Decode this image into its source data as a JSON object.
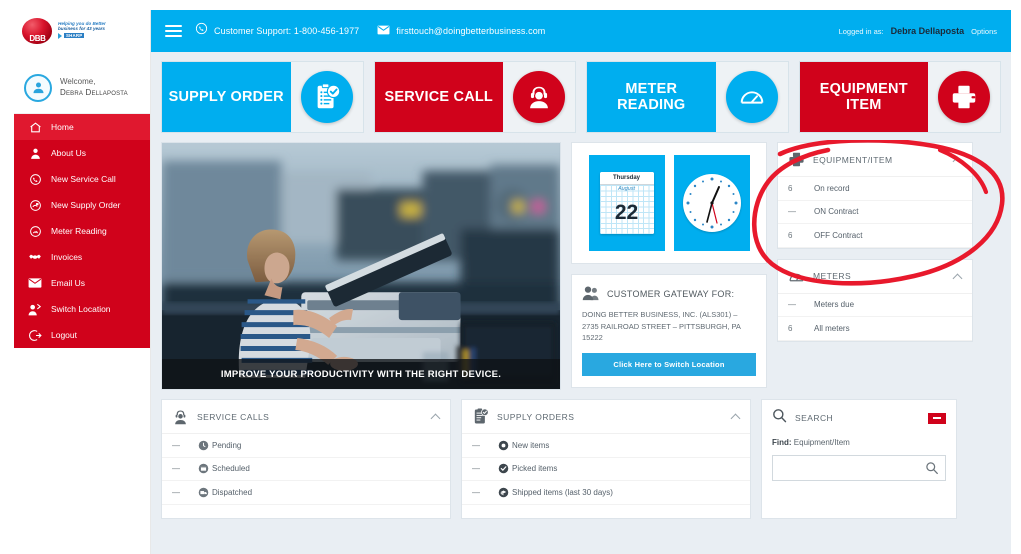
{
  "brand": {
    "mark_text": "DBB",
    "tagline_line1": "Helping you do Better",
    "tagline_line2": "business for 43 years",
    "tagline_sub": "SHARP"
  },
  "welcome": {
    "greeting": "Welcome,",
    "user_name": "Debra Dellaposta",
    "avatar_icon": "user-avatar-icon"
  },
  "sidebar": {
    "items": [
      {
        "label": "Home",
        "icon": "home-icon",
        "active": true
      },
      {
        "label": "About Us",
        "icon": "person-icon",
        "active": false
      },
      {
        "label": "New Service Call",
        "icon": "phone-icon",
        "active": false
      },
      {
        "label": "New Supply Order",
        "icon": "box-hand-icon",
        "active": false
      },
      {
        "label": "Meter Reading",
        "icon": "gauge-icon",
        "active": false
      },
      {
        "label": "Invoices",
        "icon": "handshake-icon",
        "active": false
      },
      {
        "label": "Email Us",
        "icon": "envelope-icon",
        "active": false
      },
      {
        "label": "Switch Location",
        "icon": "switch-user-icon",
        "active": false
      },
      {
        "label": "Logout",
        "icon": "logout-icon",
        "active": false
      }
    ]
  },
  "topbar": {
    "menu_icon": "hamburger-icon",
    "phone_icon": "phone-icon",
    "support_text": "Customer Support: 1-800-456-1977",
    "mail_icon": "envelope-icon",
    "email_text": "firsttouch@doingbetterbusiness.com",
    "logged_in_label": "Logged in as:",
    "user_name": "Debra Dellaposta",
    "options_label": "Options"
  },
  "tiles": [
    {
      "label": "SUPPLY ORDER",
      "color": "#00aeef",
      "style": "blue",
      "icon": "clipboard-check-icon"
    },
    {
      "label": "SERVICE CALL",
      "color": "#d0021b",
      "style": "red",
      "icon": "headset-agent-icon"
    },
    {
      "label": "METER READING",
      "color": "#00aeef",
      "style": "blue",
      "icon": "gauge-icon"
    },
    {
      "label": "EQUIPMENT ITEM",
      "color": "#d0021b",
      "style": "red",
      "icon": "printer-icon"
    }
  ],
  "hero": {
    "caption": "IMPROVE YOUR PRODUCTIVITY WITH THE RIGHT DEVICE.",
    "image_alt": "woman using office copier"
  },
  "datetime": {
    "weekday": "Thursday",
    "month": "August",
    "day": "22",
    "calendar_icon": "calendar-icon",
    "clock_icon": "analog-clock-icon"
  },
  "gateway": {
    "icon": "customers-icon",
    "title": "CUSTOMER GATEWAY FOR:",
    "address": "DOING BETTER BUSINESS, INC. (ALS301) – 2735 RAILROAD STREET – PITTSBURGH, PA 15222",
    "button_label": "Click Here to Switch Location"
  },
  "equipment_panel": {
    "icon": "printer-icon",
    "title": "EQUIPMENT/ITEM",
    "collapse_icon": "chevron-up-icon",
    "rows": [
      {
        "value": "6",
        "label": "On record"
      },
      {
        "value": "—",
        "label": "ON Contract"
      },
      {
        "value": "6",
        "label": "OFF Contract"
      }
    ]
  },
  "meters_panel": {
    "icon": "gauge-icon",
    "title": "METERS",
    "collapse_icon": "chevron-up-icon",
    "rows": [
      {
        "value": "—",
        "label": "Meters due"
      },
      {
        "value": "6",
        "label": "All meters"
      }
    ]
  },
  "service_calls_panel": {
    "icon": "headset-agent-icon",
    "title": "SERVICE CALLS",
    "collapse_icon": "chevron-up-icon",
    "rows": [
      {
        "value": "—",
        "label": "Pending",
        "dot": "clock-dot-icon"
      },
      {
        "value": "—",
        "label": "Scheduled",
        "dot": "calendar-dot-icon"
      },
      {
        "value": "—",
        "label": "Dispatched",
        "dot": "truck-dot-icon"
      }
    ]
  },
  "supply_orders_panel": {
    "icon": "clipboard-check-icon",
    "title": "SUPPLY ORDERS",
    "collapse_icon": "chevron-up-icon",
    "rows": [
      {
        "value": "—",
        "label": "New items",
        "dot": "gear-dot-icon"
      },
      {
        "value": "—",
        "label": "Picked items",
        "dot": "check-dot-icon"
      },
      {
        "value": "—",
        "label": "Shipped items (last 30 days)",
        "dot": "box-dot-icon"
      }
    ]
  },
  "search_panel": {
    "icon": "search-icon",
    "title": "SEARCH",
    "badge_icon": "minimize-badge-icon",
    "find_label": "Find:",
    "find_value": "Equipment/Item",
    "input_value": "",
    "input_placeholder": "",
    "go_icon": "search-icon"
  },
  "annotation": {
    "shape": "hand-drawn-ellipse",
    "color": "#e8192c",
    "target": "equipment-item-panel"
  }
}
